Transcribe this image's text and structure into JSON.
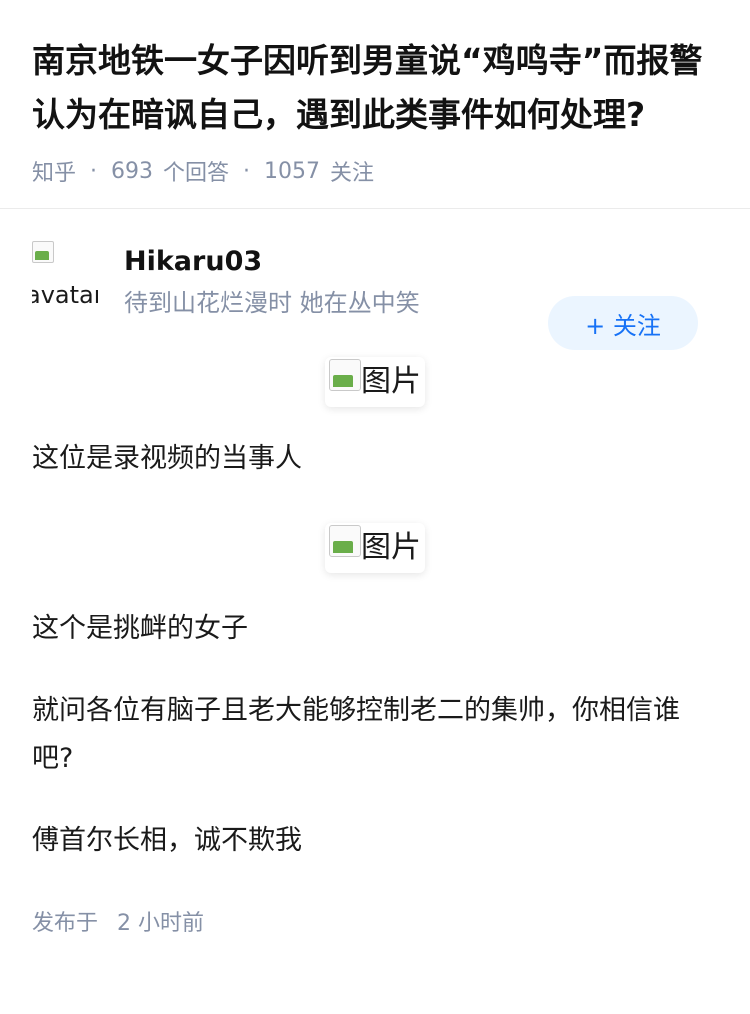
{
  "question": {
    "title": "南京地铁一女子因听到男童说“鸡鸣寺”而报警认为在暗讽自己，遇到此类事件如何处理?",
    "source": "知乎",
    "answer_count": "693",
    "answer_label": "个回答",
    "follow_count": "1057",
    "follow_label": "关注"
  },
  "answer": {
    "author_name": "Hikaru03",
    "author_bio": "待到山花烂漫时 她在丛中笑",
    "avatar_alt": "avatar",
    "follow_button": "+ 关注",
    "image_alt": "图片",
    "paragraphs": [
      "这位是录视频的当事人",
      "这个是挑衅的女子",
      "就问各位有脑子且老大能够控制老二的集帅，你相信谁吧?",
      "傅首尔长相，诚不欺我"
    ],
    "publish_label": "发布于",
    "publish_time": "2 小时前"
  }
}
